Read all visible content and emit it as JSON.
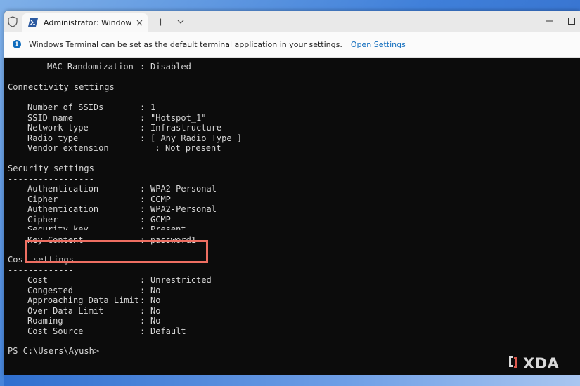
{
  "window": {
    "tab_title": "Administrator: Windows Powe"
  },
  "infobar": {
    "message": "Windows Terminal can be set as the default terminal application in your settings.",
    "link_label": "Open Settings"
  },
  "console": {
    "top_line": {
      "label": "MAC Randomization",
      "sep": ":",
      "value": "Disabled"
    },
    "sections": [
      {
        "heading": "Connectivity settings",
        "underline": "---------------------",
        "items": [
          {
            "label": "Number of SSIDs",
            "sep": ":",
            "value": "1"
          },
          {
            "label": "SSID name",
            "sep": ":",
            "value": "\"Hotspot_1\""
          },
          {
            "label": "Network type",
            "sep": ":",
            "value": "Infrastructure"
          },
          {
            "label": "Radio type",
            "sep": ":",
            "value": "[ Any Radio Type ]"
          },
          {
            "label": "Vendor extension",
            "sep": "  :",
            "value": "Not present"
          }
        ]
      },
      {
        "heading": "Security settings",
        "underline": "-----------------",
        "items": [
          {
            "label": "Authentication",
            "sep": ":",
            "value": "WPA2-Personal"
          },
          {
            "label": "Cipher",
            "sep": ":",
            "value": "CCMP"
          },
          {
            "label": "Authentication",
            "sep": ":",
            "value": "WPA2-Personal"
          },
          {
            "label": "Cipher",
            "sep": ":",
            "value": "GCMP"
          },
          {
            "label": "Security key",
            "sep": ":",
            "value": "Present"
          },
          {
            "label": "Key Content",
            "sep": ":",
            "value": "password1"
          }
        ]
      },
      {
        "heading": "Cost settings",
        "underline": "-------------",
        "items": [
          {
            "label": "Cost",
            "sep": ":",
            "value": "Unrestricted"
          },
          {
            "label": "Congested",
            "sep": ":",
            "value": "No"
          },
          {
            "label": "Approaching Data Limit",
            "sep": ":",
            "value": "No"
          },
          {
            "label": "Over Data Limit",
            "sep": ":",
            "value": "No"
          },
          {
            "label": "Roaming",
            "sep": ":",
            "value": "No"
          },
          {
            "label": "Cost Source",
            "sep": ":",
            "value": "Default"
          }
        ]
      }
    ],
    "prompt": "PS C:\\Users\\Ayush> "
  },
  "watermark": {
    "text": "XDA"
  },
  "colors": {
    "console_bg": "#0c0c0c",
    "console_fg": "#d6d6d6",
    "highlight": "#ee6f62",
    "link": "#0f6cbd"
  },
  "icons": {
    "shield": "shield-icon",
    "powershell": "powershell-icon",
    "close": "close-icon",
    "plus": "plus-icon",
    "chevron": "chevron-down-icon",
    "info": "info-icon",
    "minimize": "minimize-icon",
    "maximize": "maximize-icon",
    "xda": "xda-logo-icon"
  }
}
